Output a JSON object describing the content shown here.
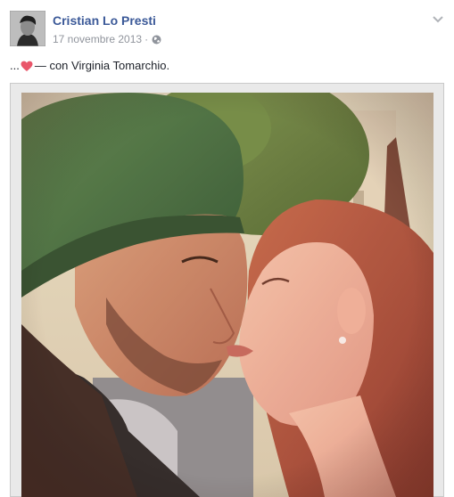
{
  "post": {
    "author_name": "Cristian Lo Presti",
    "date": "17 novembre 2013",
    "separator": "·",
    "audience_icon": "globe-icon",
    "options_icon": "chevron-down-icon",
    "status": {
      "prefix": "...",
      "emoji_icon": "heart-icon",
      "with_text": "— con",
      "tagged_name": "Virginia Tomarchio",
      "suffix": "."
    },
    "photo_icon": "photo"
  },
  "colors": {
    "link": "#3b5998",
    "meta": "#90949c",
    "text": "#1d2129",
    "heart": "#e9566a"
  }
}
